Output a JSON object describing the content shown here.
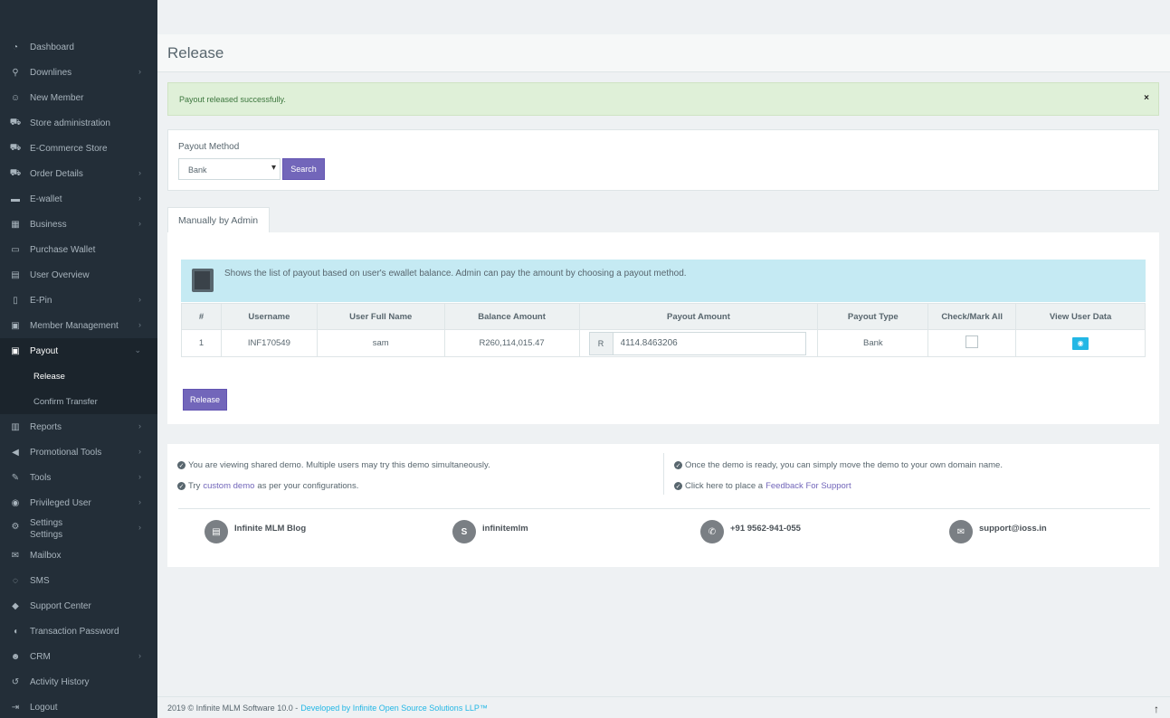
{
  "sidebar": {
    "items": [
      {
        "label": "Dashboard",
        "icon": "dashboard-icon",
        "glyph": "◔",
        "chevron": false
      },
      {
        "label": "Downlines",
        "icon": "sitemap-icon",
        "glyph": "⚲",
        "chevron": true
      },
      {
        "label": "New Member",
        "icon": "user-plus-icon",
        "glyph": "☺",
        "chevron": false
      },
      {
        "label": "Store administration",
        "icon": "cart-icon",
        "glyph": "⛟",
        "chevron": false
      },
      {
        "label": "E-Commerce Store",
        "icon": "cart-icon",
        "glyph": "⛟",
        "chevron": false
      },
      {
        "label": "Order Details",
        "icon": "cart-icon",
        "glyph": "⛟",
        "chevron": true
      },
      {
        "label": "E-wallet",
        "icon": "briefcase-icon",
        "glyph": "▬",
        "chevron": true
      },
      {
        "label": "Business",
        "icon": "building-icon",
        "glyph": "▦",
        "chevron": true
      },
      {
        "label": "Purchase Wallet",
        "icon": "wallet-icon",
        "glyph": "▭",
        "chevron": false
      },
      {
        "label": "User Overview",
        "icon": "id-card-icon",
        "glyph": "▤",
        "chevron": false
      },
      {
        "label": "E-Pin",
        "icon": "bookmark-icon",
        "glyph": "▯",
        "chevron": true
      },
      {
        "label": "Member Management",
        "icon": "user-box-icon",
        "glyph": "▣",
        "chevron": true
      },
      {
        "label": "Payout",
        "icon": "money-icon",
        "glyph": "▣",
        "chevron": true,
        "active": true
      }
    ],
    "payout_sub": [
      {
        "label": "Release",
        "current": true
      },
      {
        "label": "Confirm Transfer",
        "current": false
      }
    ],
    "items_after": [
      {
        "label": "Reports",
        "icon": "bar-chart-icon",
        "glyph": "▥",
        "chevron": true
      },
      {
        "label": "Promotional Tools",
        "icon": "bullhorn-icon",
        "glyph": "◀",
        "chevron": true
      },
      {
        "label": "Tools",
        "icon": "wrench-icon",
        "glyph": "✎",
        "chevron": true
      },
      {
        "label": "Privileged User",
        "icon": "user-circle-icon",
        "glyph": "◉",
        "chevron": true
      },
      {
        "label": "Settings",
        "icon": "cogs-icon",
        "glyph": "⚙",
        "chevron": true
      },
      {
        "label": "Mailbox",
        "icon": "envelope-icon",
        "glyph": "✉",
        "chevron": false
      },
      {
        "label": "SMS",
        "icon": "chat-icon",
        "glyph": "◌",
        "chevron": false
      },
      {
        "label": "Support Center",
        "icon": "ticket-icon",
        "glyph": "◆",
        "chevron": false
      },
      {
        "label": "Transaction Password",
        "icon": "shield-icon",
        "glyph": "◖",
        "chevron": false
      },
      {
        "label": "CRM",
        "icon": "users-icon",
        "glyph": "☻",
        "chevron": true
      },
      {
        "label": "Activity History",
        "icon": "history-icon",
        "glyph": "↺",
        "chevron": false
      },
      {
        "label": "Logout",
        "icon": "logout-icon",
        "glyph": "⇥",
        "chevron": false
      }
    ],
    "settings_dup": "Settings"
  },
  "page": {
    "title": "Release"
  },
  "alert": {
    "message": "Payout released successfully.",
    "close": "×"
  },
  "payout_method": {
    "label": "Payout Method",
    "selected": "Bank",
    "search_button": "Search"
  },
  "tab": {
    "label": "Manually by Admin"
  },
  "info": {
    "text": "Shows the list of payout based on user's ewallet balance. Admin can pay the amount by choosing a payout method."
  },
  "table": {
    "headers": [
      "#",
      "Username",
      "User Full Name",
      "Balance Amount",
      "Payout Amount",
      "Payout Type",
      "Check/Mark All",
      "View User Data"
    ],
    "rows": [
      {
        "num": "1",
        "username": "INF170549",
        "full_name": "sam",
        "balance": "R260,114,015.47",
        "currency": "R",
        "payout_amount": "4114.8463206",
        "payout_type": "Bank"
      }
    ]
  },
  "release_button": "Release",
  "demo_notes": {
    "left_1": "You are viewing shared demo. Multiple users may try this demo simultaneously.",
    "left_2_pre": "Try",
    "left_2_link": "custom demo",
    "left_2_post": "as per your configurations.",
    "right_1": "Once the demo is ready, you can simply move the demo to your own domain name.",
    "right_2_pre": "Click here to place a",
    "right_2_link": "Feedback For Support"
  },
  "contacts": [
    {
      "label": "Infinite MLM Blog",
      "icon": "blog-icon",
      "glyph": "▤"
    },
    {
      "label": "infinitemlm",
      "icon": "skype-icon",
      "glyph": "S"
    },
    {
      "label": "+91 9562-941-055",
      "icon": "whatsapp-icon",
      "glyph": "✆"
    },
    {
      "label": "support@ioss.in",
      "icon": "envelope-icon",
      "glyph": "✉"
    }
  ],
  "footer": {
    "text": "2019 © Infinite MLM Software 10.0 -",
    "link": "Developed by Infinite Open Source Solutions LLP™",
    "scroll_top": "↑"
  },
  "colors": {
    "sidebar": "#232e38",
    "primary": "#7266ba",
    "info": "#23b7e5",
    "success_bg": "#dff0d8"
  }
}
